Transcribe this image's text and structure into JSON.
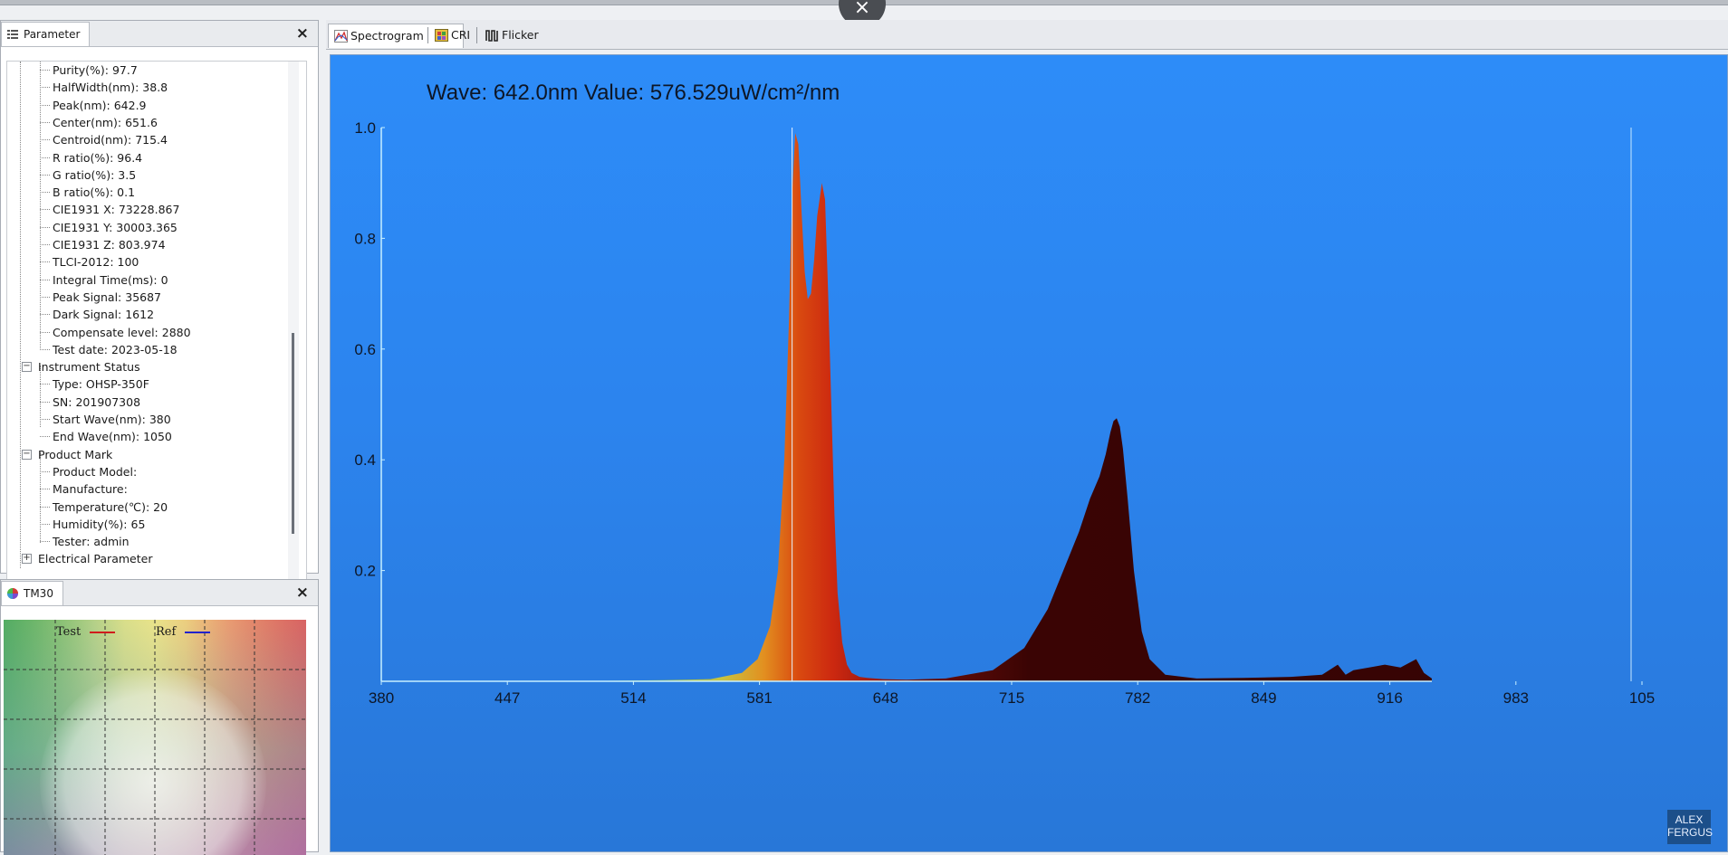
{
  "overlay": {
    "close_glyph": "×"
  },
  "parameter_panel": {
    "tab_label": "Parameter",
    "close_glyph": "×",
    "tree": [
      {
        "kind": "leaf",
        "text": "Purity(%): 97.7"
      },
      {
        "kind": "leaf",
        "text": "HalfWidth(nm): 38.8"
      },
      {
        "kind": "leaf",
        "text": "Peak(nm): 642.9"
      },
      {
        "kind": "leaf",
        "text": "Center(nm): 651.6"
      },
      {
        "kind": "leaf",
        "text": "Centroid(nm): 715.4"
      },
      {
        "kind": "leaf",
        "text": "R ratio(%): 96.4"
      },
      {
        "kind": "leaf",
        "text": "G ratio(%): 3.5"
      },
      {
        "kind": "leaf",
        "text": "B ratio(%): 0.1"
      },
      {
        "kind": "leaf",
        "text": "CIE1931 X: 73228.867"
      },
      {
        "kind": "leaf",
        "text": "CIE1931 Y: 30003.365"
      },
      {
        "kind": "leaf",
        "text": "CIE1931 Z: 803.974"
      },
      {
        "kind": "leaf",
        "text": "TLCI-2012: 100"
      },
      {
        "kind": "leaf",
        "text": "Integral Time(ms): 0"
      },
      {
        "kind": "leaf",
        "text": "Peak Signal: 35687"
      },
      {
        "kind": "leaf",
        "text": "Dark Signal: 1612"
      },
      {
        "kind": "leaf",
        "text": "Compensate level: 2880"
      },
      {
        "kind": "leaf",
        "text": "Test date: 2023-05-18"
      },
      {
        "kind": "group",
        "text": "Instrument Status",
        "toggle": "−"
      },
      {
        "kind": "leaf",
        "text": "Type: OHSP-350F"
      },
      {
        "kind": "leaf",
        "text": "SN: 201907308"
      },
      {
        "kind": "leaf",
        "text": "Start Wave(nm): 380"
      },
      {
        "kind": "leaf",
        "text": "End Wave(nm): 1050"
      },
      {
        "kind": "group",
        "text": "Product Mark",
        "toggle": "−"
      },
      {
        "kind": "leaf",
        "text": "Product Model:"
      },
      {
        "kind": "leaf",
        "text": "Manufacture:"
      },
      {
        "kind": "leaf",
        "text": "Temperature(℃): 20"
      },
      {
        "kind": "leaf",
        "text": "Humidity(%): 65"
      },
      {
        "kind": "leaf",
        "text": "Tester: admin"
      },
      {
        "kind": "group",
        "text": "Electrical Parameter",
        "toggle": "+"
      }
    ]
  },
  "tm30_panel": {
    "tab_label": "TM30",
    "close_glyph": "×",
    "legend": {
      "test_label": "Test",
      "ref_label": "Ref",
      "test_color": "#d01c1c",
      "ref_color": "#2222cc"
    }
  },
  "tabs": [
    {
      "label": "Spectrogram",
      "icon": "spectrogram-icon",
      "active": true
    },
    {
      "label": "CRI",
      "icon": "cri-icon",
      "active": false
    },
    {
      "label": "Flicker",
      "icon": "flicker-icon",
      "active": false
    }
  ],
  "readout": {
    "text": "Wave: 642.0nm Value: 576.529uW/cm²/nm"
  },
  "watermark": {
    "line1": "ALEX",
    "line2": "FERGUS"
  },
  "chart_data": {
    "type": "area",
    "xlim": [
      380,
      1050
    ],
    "ylim": [
      0,
      1.0
    ],
    "x_ticks": [
      "380",
      "447",
      "514",
      "581",
      "648",
      "715",
      "782",
      "849",
      "916",
      "983",
      "105"
    ],
    "y_ticks": [
      "0.2",
      "0.4",
      "0.6",
      "0.8",
      "1.0"
    ],
    "cursor_x": 642.0,
    "x": [
      380,
      500,
      560,
      590,
      610,
      620,
      628,
      633,
      637,
      640,
      642,
      644,
      646,
      648,
      650,
      652,
      654,
      656,
      658,
      661,
      663,
      665,
      667,
      669,
      671,
      674,
      677,
      680,
      685,
      690,
      700,
      715,
      740,
      770,
      790,
      805,
      815,
      825,
      832,
      838,
      842,
      845,
      847,
      849,
      851,
      853,
      856,
      860,
      865,
      870,
      880,
      900,
      930,
      960,
      980,
      990,
      995,
      1000,
      1010,
      1020,
      1030,
      1040,
      1045,
      1050
    ],
    "y": [
      0,
      0,
      0.002,
      0.004,
      0.015,
      0.04,
      0.1,
      0.2,
      0.4,
      0.65,
      0.88,
      0.99,
      0.97,
      0.85,
      0.74,
      0.69,
      0.7,
      0.76,
      0.84,
      0.9,
      0.87,
      0.7,
      0.5,
      0.3,
      0.16,
      0.07,
      0.03,
      0.015,
      0.008,
      0.006,
      0.004,
      0.003,
      0.005,
      0.02,
      0.06,
      0.13,
      0.2,
      0.27,
      0.33,
      0.37,
      0.41,
      0.45,
      0.47,
      0.475,
      0.46,
      0.42,
      0.33,
      0.2,
      0.09,
      0.04,
      0.012,
      0.005,
      0.006,
      0.008,
      0.012,
      0.03,
      0.012,
      0.02,
      0.025,
      0.03,
      0.025,
      0.04,
      0.015,
      0.005
    ]
  }
}
